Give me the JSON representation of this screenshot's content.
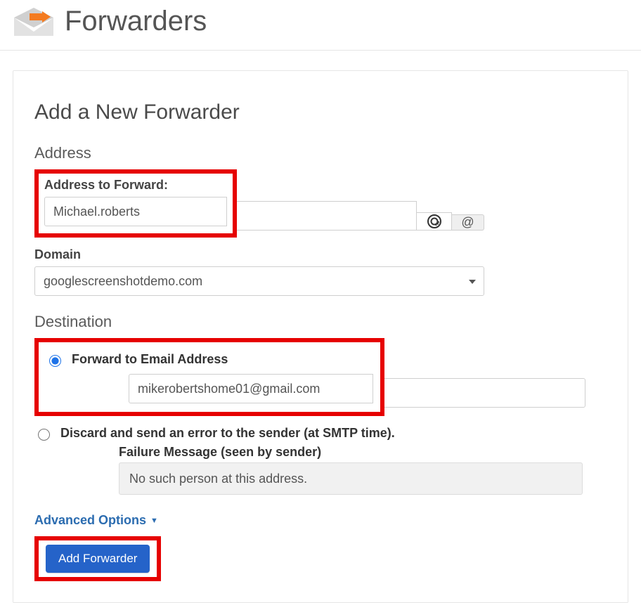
{
  "header": {
    "title": "Forwarders"
  },
  "panel": {
    "heading": "Add a New Forwarder",
    "address_section": "Address",
    "address_to_forward_label": "Address to Forward:",
    "address_value": "Michael.roberts",
    "at_symbol": "@",
    "domain_label": "Domain",
    "domain_value": "googlescreenshotdemo.com",
    "destination_section": "Destination",
    "forward_radio_label": "Forward to Email Address",
    "forward_email_value": "mikerobertshome01@gmail.com",
    "discard_radio_label": "Discard and send an error to the sender (at SMTP time).",
    "failure_message_label": "Failure Message (seen by sender)",
    "failure_message_value": "No such person at this address.",
    "advanced_options": "Advanced Options",
    "submit_button": "Add Forwarder"
  }
}
